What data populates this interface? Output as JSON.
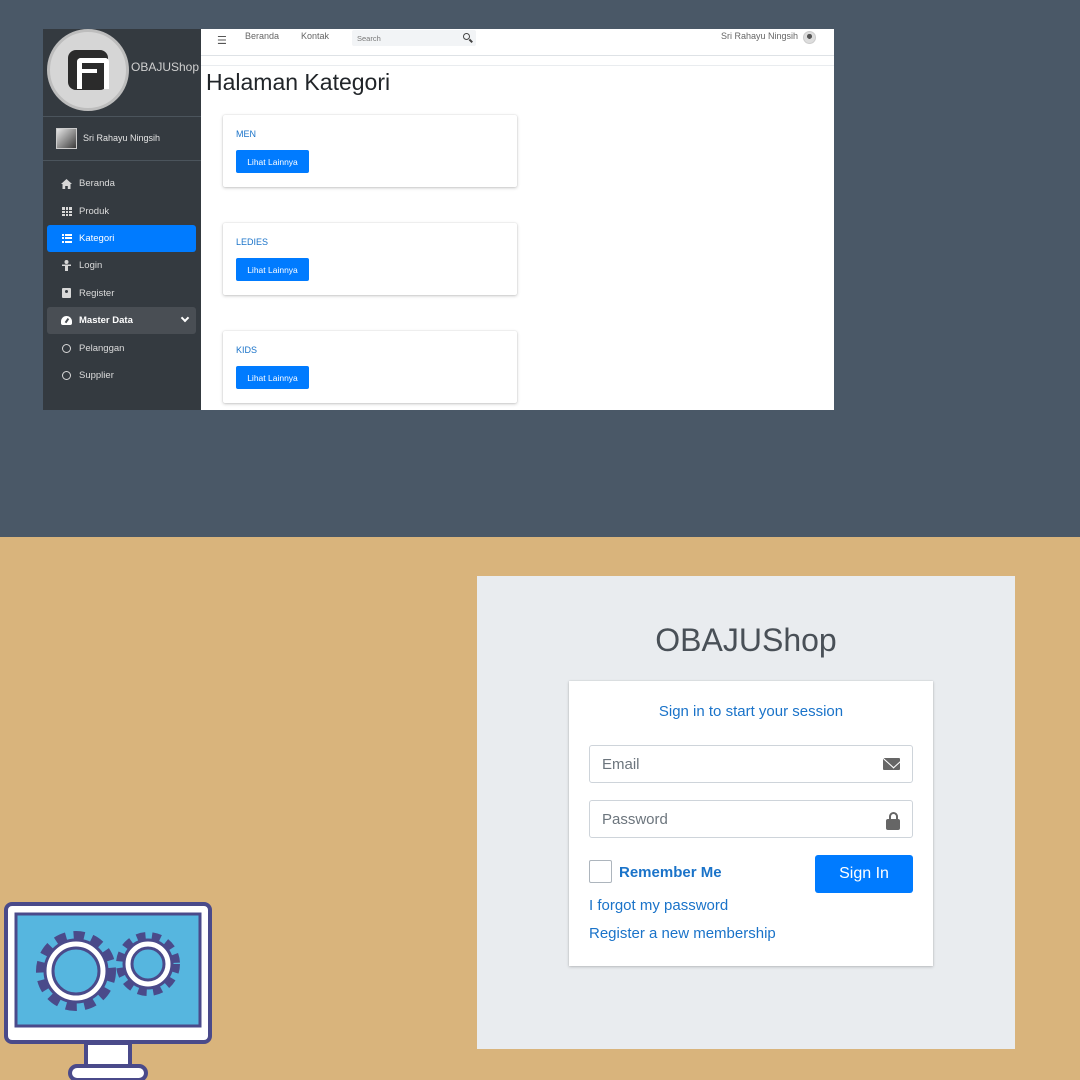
{
  "admin": {
    "brand": "OBAJUShop",
    "user_name": "Sri Rahayu Ningsih",
    "sidebar_items": [
      {
        "label": "Beranda",
        "icon": "home-icon"
      },
      {
        "label": "Produk",
        "icon": "grid-icon"
      },
      {
        "label": "Kategori",
        "icon": "list-icon",
        "active": true
      },
      {
        "label": "Login",
        "icon": "person-icon"
      },
      {
        "label": "Register",
        "icon": "id-card-icon"
      },
      {
        "label": "Master Data",
        "icon": "gauge-icon",
        "expanded": true
      },
      {
        "label": "Pelanggan",
        "icon": "circle-icon"
      },
      {
        "label": "Supplier",
        "icon": "circle-icon"
      }
    ],
    "topbar": {
      "links": [
        "Beranda",
        "Kontak"
      ],
      "search_placeholder": "Search",
      "user": "Sri Rahayu Ningsih"
    },
    "page_title": "Halaman Kategori",
    "categories": [
      {
        "name": "MEN",
        "button": "Lihat Lainnya"
      },
      {
        "name": "LEDIES",
        "button": "Lihat Lainnya"
      },
      {
        "name": "KIDS",
        "button": "Lihat Lainnya"
      }
    ]
  },
  "login": {
    "logo": "OBAJUShop",
    "message": "Sign in to start your session",
    "email_placeholder": "Email",
    "password_placeholder": "Password",
    "remember_label": "Remember Me",
    "signin_label": "Sign In",
    "forgot_link": "I forgot my password",
    "register_link": "Register a new membership"
  },
  "colors": {
    "top_background": "#4a5867",
    "bottom_background": "#d9b47c",
    "sidebar": "#343a40",
    "primary": "#007bff",
    "link": "#1a73c9",
    "monitor_screen": "#56b6df",
    "monitor_frame": "#4a4a8a"
  }
}
